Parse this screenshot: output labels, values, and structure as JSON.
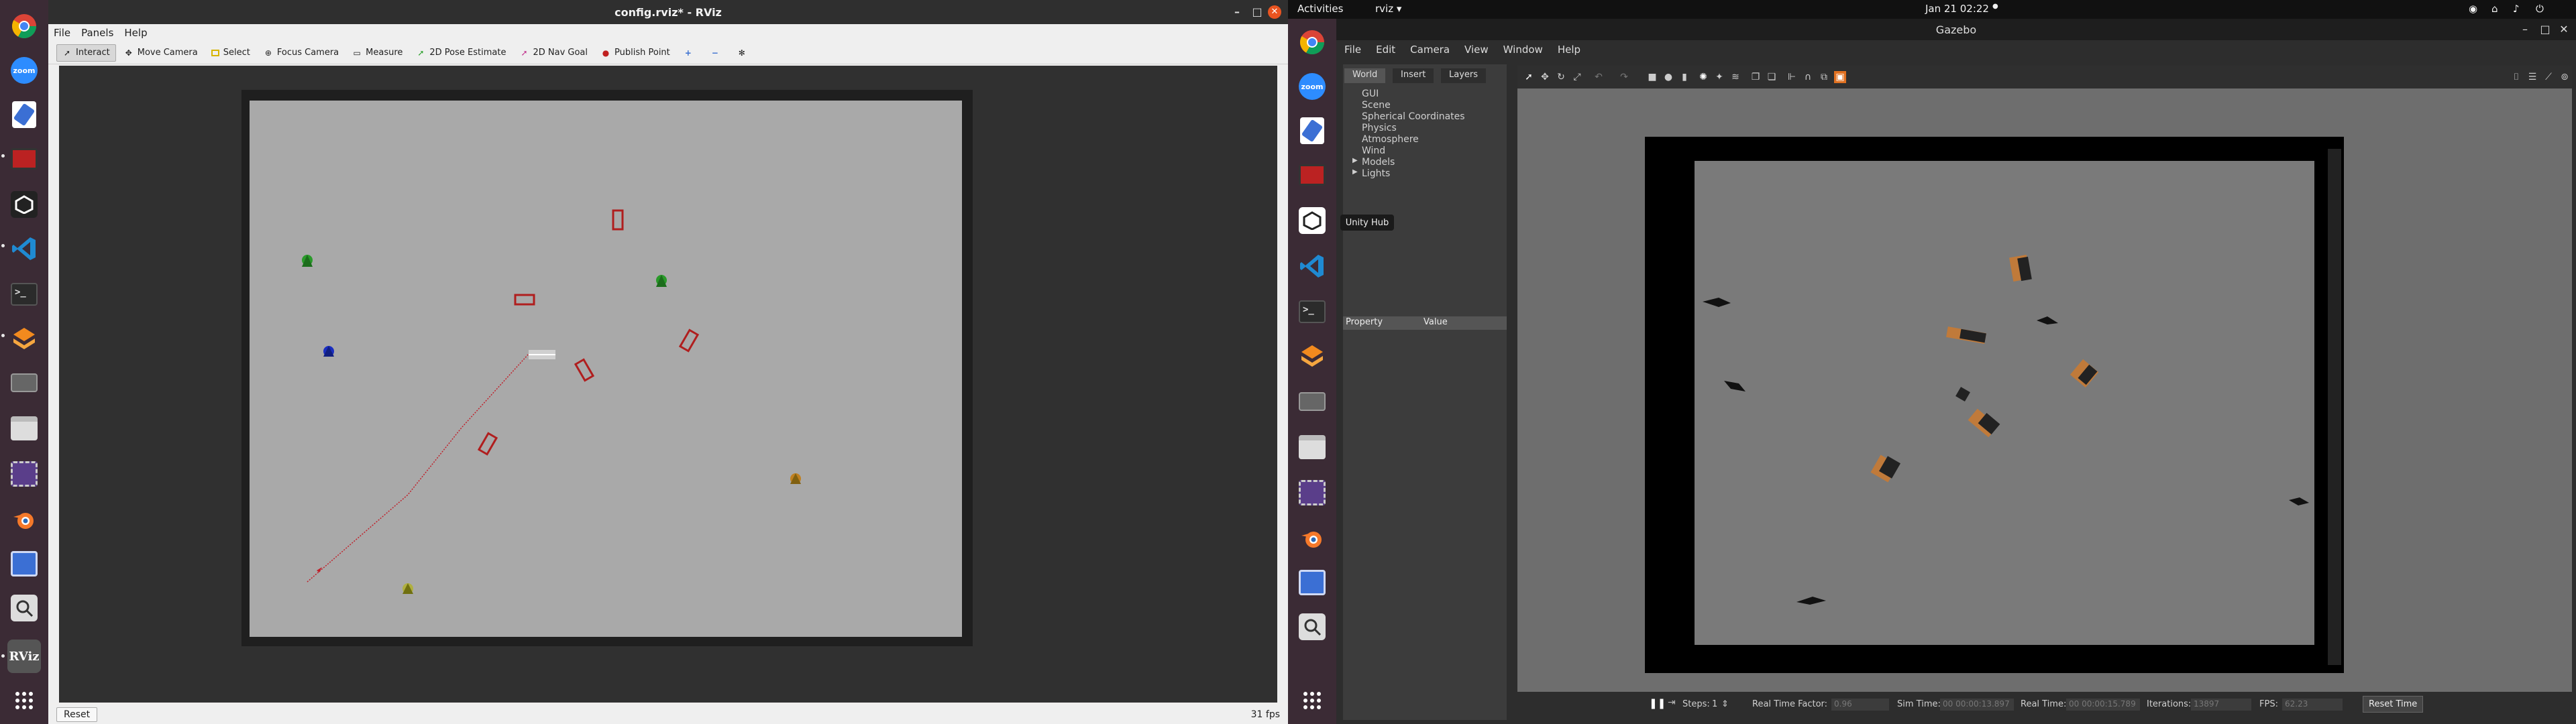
{
  "rviz": {
    "title": "config.rviz* - RViz",
    "menu": [
      "File",
      "Panels",
      "Help"
    ],
    "tools": [
      "Interact",
      "Move Camera",
      "Select",
      "Focus Camera",
      "Measure",
      "2D Pose Estimate",
      "2D Nav Goal",
      "Publish Point"
    ],
    "reset": "Reset",
    "fps": "31 fps",
    "colors": {
      "obstacle": "#b01e1e",
      "path": "#c0202a",
      "map_bg": "#a9a9a9"
    }
  },
  "topbar": {
    "activities": "Activities",
    "app": "rviz",
    "clock": "Jan 21  02:22"
  },
  "gazebo": {
    "title": "Gazebo",
    "menu": [
      "File",
      "Edit",
      "Camera",
      "View",
      "Window",
      "Help"
    ],
    "tabs": [
      "World",
      "Insert",
      "Layers"
    ],
    "tree": [
      "GUI",
      "Scene",
      "Spherical Coordinates",
      "Physics",
      "Atmosphere",
      "Wind",
      "Models",
      "Lights"
    ],
    "property_header": [
      "Property",
      "Value"
    ],
    "steps_label": "Steps:",
    "steps_value": "1",
    "rtf_label": "Real Time Factor:",
    "rtf_value": "0.96",
    "simtime_label": "Sim Time:",
    "simtime_value": "00 00:00:13.897",
    "realtime_label": "Real Time:",
    "realtime_value": "00 00:00:15.789",
    "iterations_label": "Iterations:",
    "iterations_value": "13897",
    "fps_label": "FPS:",
    "fps_value": "62.23",
    "reset_time": "Reset Time"
  },
  "dock": {
    "tooltip": "Unity Hub",
    "zoom_label": "zoom",
    "rviz_label": "RViz"
  }
}
